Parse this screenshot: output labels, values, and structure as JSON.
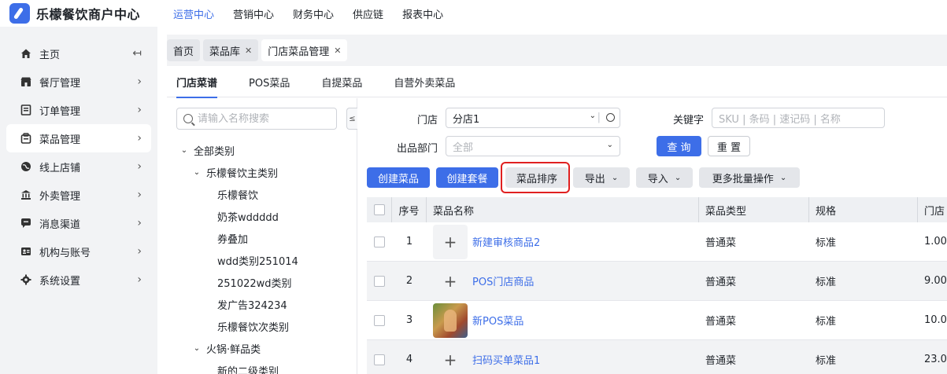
{
  "app": {
    "title": "乐檬餐饮商户中心"
  },
  "topnav": [
    {
      "label": "运营中心",
      "active": true
    },
    {
      "label": "营销中心",
      "active": false
    },
    {
      "label": "财务中心",
      "active": false
    },
    {
      "label": "供应链",
      "active": false
    },
    {
      "label": "报表中心",
      "active": false
    }
  ],
  "sidebar": {
    "items": [
      {
        "label": "主页",
        "icon": "home-icon",
        "active": false
      },
      {
        "label": "餐厅管理",
        "icon": "restaurant-icon",
        "active": false
      },
      {
        "label": "订单管理",
        "icon": "order-icon",
        "active": false
      },
      {
        "label": "菜品管理",
        "icon": "dish-icon",
        "active": true
      },
      {
        "label": "线上店铺",
        "icon": "globe-icon",
        "active": false
      },
      {
        "label": "外卖管理",
        "icon": "bank-icon",
        "active": false
      },
      {
        "label": "消息渠道",
        "icon": "chat-icon",
        "active": false
      },
      {
        "label": "机构与账号",
        "icon": "id-card-icon",
        "active": false
      },
      {
        "label": "系统设置",
        "icon": "gear-icon",
        "active": false
      }
    ]
  },
  "tabs": [
    {
      "label": "首页",
      "closable": false,
      "active": false
    },
    {
      "label": "菜品库",
      "closable": true,
      "active": false
    },
    {
      "label": "门店菜品管理",
      "closable": true,
      "active": true
    }
  ],
  "subtabs": [
    {
      "label": "门店菜谱",
      "active": true
    },
    {
      "label": "POS菜品",
      "active": false
    },
    {
      "label": "自提菜品",
      "active": false
    },
    {
      "label": "自营外卖菜品",
      "active": false
    }
  ],
  "tree": {
    "search_placeholder": "请输入名称搜索",
    "toggle_label": "≤",
    "nodes": [
      {
        "label": "全部类别",
        "level": 0,
        "expandable": true
      },
      {
        "label": "乐檬餐饮主类别",
        "level": 1,
        "expandable": true
      },
      {
        "label": "乐檬餐饮",
        "level": 2,
        "expandable": false
      },
      {
        "label": "奶茶wddddd",
        "level": 2,
        "expandable": false
      },
      {
        "label": "券叠加",
        "level": 2,
        "expandable": false
      },
      {
        "label": "wdd类别251014",
        "level": 2,
        "expandable": false
      },
      {
        "label": "251022wd类别",
        "level": 2,
        "expandable": false
      },
      {
        "label": "发广告324234",
        "level": 2,
        "expandable": false
      },
      {
        "label": "乐檬餐饮次类别",
        "level": 2,
        "expandable": false
      },
      {
        "label": "火锅·鲜品类",
        "level": 1,
        "expandable": true
      },
      {
        "label": "新的二级类别",
        "level": 2,
        "expandable": false
      }
    ]
  },
  "filters": {
    "store_label": "门店",
    "store_value": "分店1",
    "keyword_label": "关键字",
    "keyword_placeholder": "SKU | 条码 | 速记码 | 名称",
    "dept_label": "出品部门",
    "dept_placeholder": "全部",
    "query_label": "查 询",
    "reset_label": "重 置"
  },
  "actions": {
    "create_dish": "创建菜品",
    "create_combo": "创建套餐",
    "dish_sort": "菜品排序",
    "export": "导出",
    "import": "导入",
    "more_batch": "更多批量操作"
  },
  "table": {
    "columns": [
      "序号",
      "菜品名称",
      "菜品类型",
      "规格",
      "门店"
    ],
    "rows": [
      {
        "seq": "1",
        "name": "新建审核商品2",
        "type": "普通菜",
        "spec": "标准",
        "store_price": "1.00",
        "has_image": false
      },
      {
        "seq": "2",
        "name": "POS门店商品",
        "type": "普通菜",
        "spec": "标准",
        "store_price": "9.00",
        "has_image": false
      },
      {
        "seq": "3",
        "name": "新POS菜品",
        "type": "普通菜",
        "spec": "标准",
        "store_price": "10.0",
        "has_image": true
      },
      {
        "seq": "4",
        "name": "扫码买单菜品1",
        "type": "普通菜",
        "spec": "标准",
        "store_price": "23.0",
        "has_image": false
      }
    ]
  },
  "colors": {
    "accent": "#3d6ee8",
    "highlight": "#e02020",
    "sidebar_bg": "#f2f3f5"
  }
}
